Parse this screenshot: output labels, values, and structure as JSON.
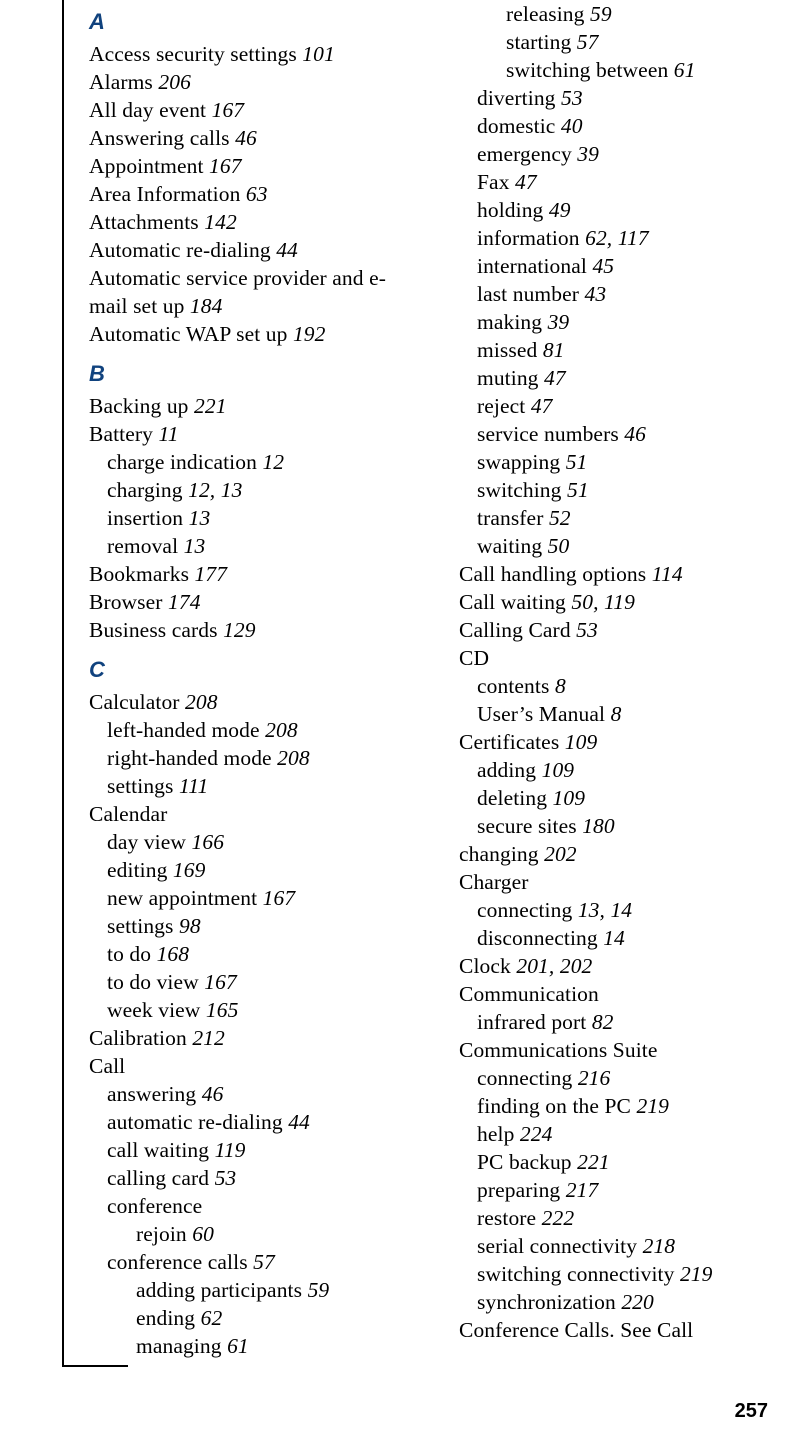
{
  "page": {
    "folio": "257",
    "heading_color": "#10427E",
    "text_color": "#000000",
    "background_color": "#ffffff"
  },
  "columns": [
    {
      "name": "left-column",
      "blocks": [
        {
          "type": "heading",
          "label": "A"
        },
        {
          "type": "entry",
          "level": 1,
          "text": "Access security settings ",
          "pages": "101"
        },
        {
          "type": "entry",
          "level": 1,
          "text": "Alarms ",
          "pages": "206"
        },
        {
          "type": "entry",
          "level": 1,
          "text": "All day event ",
          "pages": "167"
        },
        {
          "type": "entry",
          "level": 1,
          "text": "Answering calls ",
          "pages": "46"
        },
        {
          "type": "entry",
          "level": 1,
          "text": "Appointment ",
          "pages": "167"
        },
        {
          "type": "entry",
          "level": 1,
          "text": "Area Information ",
          "pages": "63"
        },
        {
          "type": "entry",
          "level": 1,
          "text": "Attachments ",
          "pages": "142"
        },
        {
          "type": "entry",
          "level": 1,
          "text": "Automatic re-dialing ",
          "pages": "44"
        },
        {
          "type": "entry",
          "level": 1,
          "text": "Automatic service provider and e-mail set up ",
          "pages": "184"
        },
        {
          "type": "entry",
          "level": 1,
          "text": "Automatic WAP set up ",
          "pages": "192"
        },
        {
          "type": "heading",
          "label": "B"
        },
        {
          "type": "entry",
          "level": 1,
          "text": "Backing up ",
          "pages": "221"
        },
        {
          "type": "entry",
          "level": 1,
          "text": "Battery ",
          "pages": "11"
        },
        {
          "type": "entry",
          "level": 2,
          "text": "charge indication ",
          "pages": "12"
        },
        {
          "type": "entry",
          "level": 2,
          "text": "charging ",
          "pages": "12, 13"
        },
        {
          "type": "entry",
          "level": 2,
          "text": "insertion ",
          "pages": "13"
        },
        {
          "type": "entry",
          "level": 2,
          "text": "removal ",
          "pages": "13"
        },
        {
          "type": "entry",
          "level": 1,
          "text": "Bookmarks ",
          "pages": "177"
        },
        {
          "type": "entry",
          "level": 1,
          "text": "Browser ",
          "pages": "174"
        },
        {
          "type": "entry",
          "level": 1,
          "text": "Business cards ",
          "pages": "129"
        },
        {
          "type": "heading",
          "label": "C"
        },
        {
          "type": "entry",
          "level": 1,
          "text": "Calculator ",
          "pages": "208"
        },
        {
          "type": "entry",
          "level": 2,
          "text": "left-handed mode ",
          "pages": "208"
        },
        {
          "type": "entry",
          "level": 2,
          "text": "right-handed mode ",
          "pages": "208"
        },
        {
          "type": "entry",
          "level": 2,
          "text": "settings ",
          "pages": "111"
        },
        {
          "type": "entry",
          "level": 1,
          "text": "Calendar",
          "pages": ""
        },
        {
          "type": "entry",
          "level": 2,
          "text": "day view ",
          "pages": "166"
        },
        {
          "type": "entry",
          "level": 2,
          "text": "editing ",
          "pages": "169"
        },
        {
          "type": "entry",
          "level": 2,
          "text": "new appointment ",
          "pages": "167"
        },
        {
          "type": "entry",
          "level": 2,
          "text": "settings ",
          "pages": "98"
        },
        {
          "type": "entry",
          "level": 2,
          "text": "to do ",
          "pages": "168"
        },
        {
          "type": "entry",
          "level": 2,
          "text": "to do view ",
          "pages": "167"
        },
        {
          "type": "entry",
          "level": 2,
          "text": "week view ",
          "pages": "165"
        },
        {
          "type": "entry",
          "level": 1,
          "text": "Calibration ",
          "pages": "212"
        },
        {
          "type": "entry",
          "level": 1,
          "text": "Call",
          "pages": ""
        },
        {
          "type": "entry",
          "level": 2,
          "text": "answering ",
          "pages": "46"
        },
        {
          "type": "entry",
          "level": 2,
          "text": "automatic re-dialing ",
          "pages": "44"
        },
        {
          "type": "entry",
          "level": 2,
          "text": "call waiting ",
          "pages": "119"
        },
        {
          "type": "entry",
          "level": 2,
          "text": "calling card ",
          "pages": "53"
        },
        {
          "type": "entry",
          "level": 2,
          "text": "conference",
          "pages": ""
        },
        {
          "type": "entry",
          "level": 3,
          "text": "rejoin ",
          "pages": "60"
        },
        {
          "type": "entry",
          "level": 2,
          "text": "conference calls ",
          "pages": "57"
        },
        {
          "type": "entry",
          "level": 3,
          "text": "adding participants ",
          "pages": "59"
        },
        {
          "type": "entry",
          "level": 3,
          "text": "ending ",
          "pages": "62"
        },
        {
          "type": "entry",
          "level": 3,
          "text": "managing ",
          "pages": "61"
        }
      ]
    },
    {
      "name": "right-column",
      "blocks": [
        {
          "type": "entry",
          "level": 3,
          "text": "releasing ",
          "pages": "59"
        },
        {
          "type": "entry",
          "level": 3,
          "text": "starting ",
          "pages": "57"
        },
        {
          "type": "entry",
          "level": 3,
          "text": "switching between ",
          "pages": "61"
        },
        {
          "type": "entry",
          "level": 2,
          "text": "diverting ",
          "pages": "53"
        },
        {
          "type": "entry",
          "level": 2,
          "text": "domestic ",
          "pages": "40"
        },
        {
          "type": "entry",
          "level": 2,
          "text": "emergency ",
          "pages": "39"
        },
        {
          "type": "entry",
          "level": 2,
          "text": "Fax ",
          "pages": "47"
        },
        {
          "type": "entry",
          "level": 2,
          "text": "holding ",
          "pages": "49"
        },
        {
          "type": "entry",
          "level": 2,
          "text": "information ",
          "pages": "62, 117"
        },
        {
          "type": "entry",
          "level": 2,
          "text": "international ",
          "pages": "45"
        },
        {
          "type": "entry",
          "level": 2,
          "text": "last number ",
          "pages": "43"
        },
        {
          "type": "entry",
          "level": 2,
          "text": "making ",
          "pages": "39"
        },
        {
          "type": "entry",
          "level": 2,
          "text": "missed ",
          "pages": "81"
        },
        {
          "type": "entry",
          "level": 2,
          "text": "muting ",
          "pages": "47"
        },
        {
          "type": "entry",
          "level": 2,
          "text": "reject ",
          "pages": "47"
        },
        {
          "type": "entry",
          "level": 2,
          "text": "service numbers ",
          "pages": "46"
        },
        {
          "type": "entry",
          "level": 2,
          "text": "swapping ",
          "pages": "51"
        },
        {
          "type": "entry",
          "level": 2,
          "text": "switching ",
          "pages": "51"
        },
        {
          "type": "entry",
          "level": 2,
          "text": "transfer ",
          "pages": "52"
        },
        {
          "type": "entry",
          "level": 2,
          "text": "waiting ",
          "pages": "50"
        },
        {
          "type": "entry",
          "level": 1,
          "text": "Call handling options ",
          "pages": "114"
        },
        {
          "type": "entry",
          "level": 1,
          "text": "Call waiting ",
          "pages": "50, 119"
        },
        {
          "type": "entry",
          "level": 1,
          "text": "Calling Card ",
          "pages": "53"
        },
        {
          "type": "entry",
          "level": 1,
          "text": "CD",
          "pages": ""
        },
        {
          "type": "entry",
          "level": 2,
          "text": "contents ",
          "pages": "8"
        },
        {
          "type": "entry",
          "level": 2,
          "text": "User’s Manual ",
          "pages": "8"
        },
        {
          "type": "entry",
          "level": 1,
          "text": "Certificates ",
          "pages": "109"
        },
        {
          "type": "entry",
          "level": 2,
          "text": "adding ",
          "pages": "109"
        },
        {
          "type": "entry",
          "level": 2,
          "text": "deleting ",
          "pages": "109"
        },
        {
          "type": "entry",
          "level": 2,
          "text": "secure sites ",
          "pages": "180"
        },
        {
          "type": "entry",
          "level": 1,
          "text": "changing ",
          "pages": "202"
        },
        {
          "type": "entry",
          "level": 1,
          "text": "Charger",
          "pages": ""
        },
        {
          "type": "entry",
          "level": 2,
          "text": "connecting ",
          "pages": "13, 14"
        },
        {
          "type": "entry",
          "level": 2,
          "text": "disconnecting ",
          "pages": "14"
        },
        {
          "type": "entry",
          "level": 1,
          "text": "Clock ",
          "pages": "201, 202"
        },
        {
          "type": "entry",
          "level": 1,
          "text": "Communication",
          "pages": ""
        },
        {
          "type": "entry",
          "level": 2,
          "text": "infrared port ",
          "pages": "82"
        },
        {
          "type": "entry",
          "level": 1,
          "text": "Communications Suite",
          "pages": ""
        },
        {
          "type": "entry",
          "level": 2,
          "text": "connecting ",
          "pages": "216"
        },
        {
          "type": "entry",
          "level": 2,
          "text": "finding on the PC ",
          "pages": "219"
        },
        {
          "type": "entry",
          "level": 2,
          "text": "help ",
          "pages": "224"
        },
        {
          "type": "entry",
          "level": 2,
          "text": "PC backup ",
          "pages": "221"
        },
        {
          "type": "entry",
          "level": 2,
          "text": "preparing ",
          "pages": "217"
        },
        {
          "type": "entry",
          "level": 2,
          "text": "restore ",
          "pages": "222"
        },
        {
          "type": "entry",
          "level": 2,
          "text": "serial connectivity ",
          "pages": "218"
        },
        {
          "type": "entry",
          "level": 2,
          "text": "switching connectivity ",
          "pages": "219"
        },
        {
          "type": "entry",
          "level": 2,
          "text": "synchronization ",
          "pages": "220"
        },
        {
          "type": "entry",
          "level": 1,
          "text": "Conference Calls. See Call",
          "pages": ""
        }
      ]
    }
  ]
}
